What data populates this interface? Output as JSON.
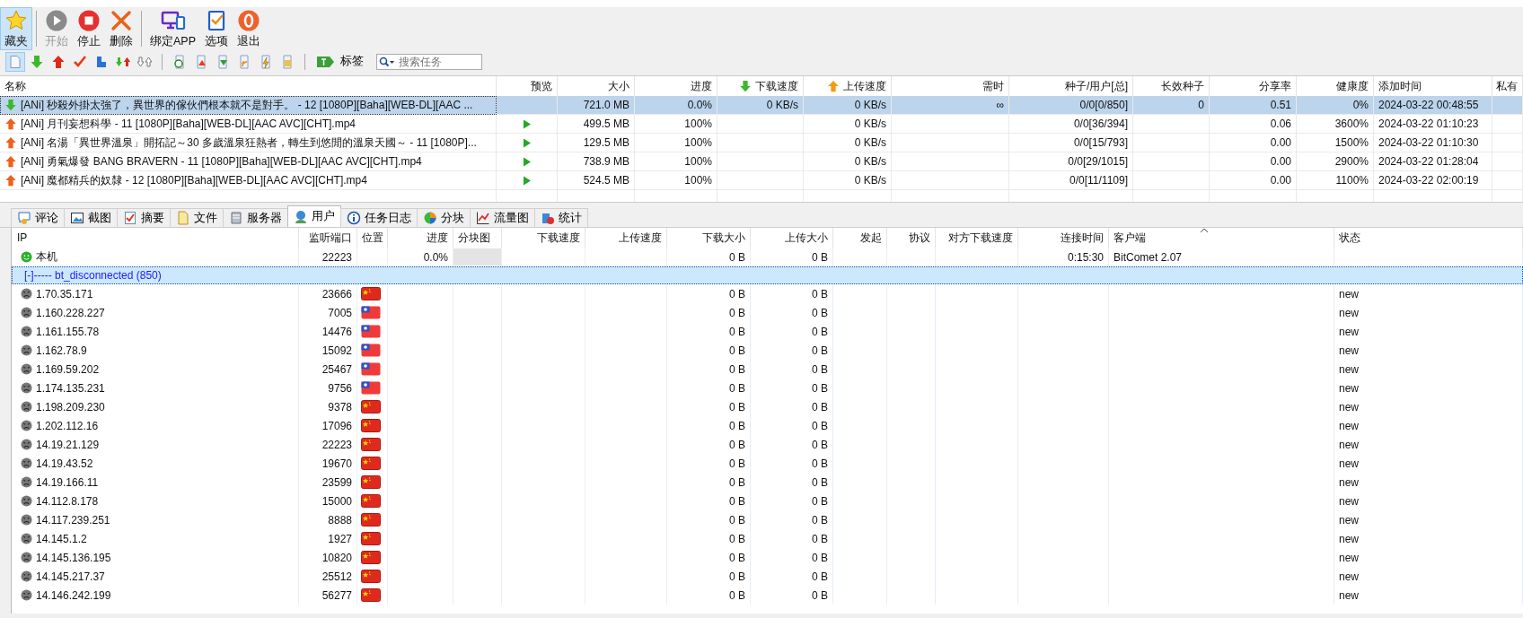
{
  "toolbar": {
    "buttons": [
      {
        "kind": "star",
        "label": "藏夹",
        "selected": true,
        "disabled": false
      },
      {
        "kind": "play",
        "label": "开始",
        "selected": false,
        "disabled": true
      },
      {
        "kind": "stop",
        "label": "停止",
        "selected": false,
        "disabled": false
      },
      {
        "kind": "delete",
        "label": "删除",
        "selected": false,
        "disabled": false
      },
      {
        "kind": "device",
        "label": "绑定APP",
        "selected": false,
        "disabled": false
      },
      {
        "kind": "options",
        "label": "选项",
        "selected": false,
        "disabled": false
      },
      {
        "kind": "exit",
        "label": "退出",
        "selected": false,
        "disabled": false
      }
    ]
  },
  "filter_bar": {
    "filters": [
      {
        "kind": "all",
        "selected": true
      },
      {
        "kind": "down",
        "selected": false
      },
      {
        "kind": "up",
        "selected": false
      },
      {
        "kind": "done",
        "selected": false
      },
      {
        "kind": "queue",
        "selected": false
      },
      {
        "kind": "updown",
        "selected": false
      },
      {
        "kind": "idle",
        "selected": false
      }
    ],
    "tools": [
      {
        "kind": "clock"
      },
      {
        "kind": "doc-up"
      },
      {
        "kind": "doc-down"
      },
      {
        "kind": "rss"
      },
      {
        "kind": "bolt"
      },
      {
        "kind": "folder"
      }
    ],
    "tag_button": "标签",
    "search": {
      "placeholder": "搜索任务"
    }
  },
  "tasks": {
    "columns": [
      "名称",
      "预览",
      "大小",
      "进度",
      "下载速度",
      "上传速度",
      "需时",
      "种子/用户[总]",
      "长效种子",
      "分享率",
      "健康度",
      "添加时间",
      "私有"
    ],
    "rows": [
      {
        "kind": "download",
        "selected": true,
        "preview": false,
        "name": "[ANi] 秒殺外掛太強了，異世界的傢伙們根本就不是對手。 - 12 [1080P][Baha][WEB-DL][AAC ...",
        "size": "721.0 MB",
        "progress": "0.0%",
        "download_speed": "0 KB/s",
        "upload_speed": "0 KB/s",
        "eta": "∞",
        "seeds_peers": "0/0[0/850]",
        "long_seeds": "0",
        "share_ratio": "0.51",
        "health": "0%",
        "added": "2024-03-22 00:48:55"
      },
      {
        "kind": "upload",
        "selected": false,
        "preview": true,
        "name": "[ANi] 月刊妄想科學 - 11 [1080P][Baha][WEB-DL][AAC AVC][CHT].mp4",
        "size": "499.5 MB",
        "progress": "100%",
        "upload_speed": "0 KB/s",
        "seeds_peers": "0/0[36/394]",
        "share_ratio": "0.06",
        "health": "3600%",
        "added": "2024-03-22 01:10:23"
      },
      {
        "kind": "upload",
        "selected": false,
        "preview": true,
        "name": "[ANi] 名湯「異世界溫泉」開拓記～30 多歲溫泉狂熱者，轉生到悠閒的溫泉天國～ - 11 [1080P]...",
        "size": "129.5 MB",
        "progress": "100%",
        "upload_speed": "0 KB/s",
        "seeds_peers": "0/0[15/793]",
        "share_ratio": "0.00",
        "health": "1500%",
        "added": "2024-03-22 01:10:30"
      },
      {
        "kind": "upload",
        "selected": false,
        "preview": true,
        "name": "[ANi] 勇氣爆發 BANG BRAVERN - 11 [1080P][Baha][WEB-DL][AAC AVC][CHT].mp4",
        "size": "738.9 MB",
        "progress": "100%",
        "upload_speed": "0 KB/s",
        "seeds_peers": "0/0[29/1015]",
        "share_ratio": "0.00",
        "health": "2900%",
        "added": "2024-03-22 01:28:04"
      },
      {
        "kind": "upload",
        "selected": false,
        "preview": true,
        "name": "[ANi] 魔都精兵的奴隸 - 12 [1080P][Baha][WEB-DL][AAC AVC][CHT].mp4",
        "size": "524.5 MB",
        "progress": "100%",
        "upload_speed": "0 KB/s",
        "seeds_peers": "0/0[11/1109]",
        "share_ratio": "0.00",
        "health": "1100%",
        "added": "2024-03-22 02:00:19"
      }
    ]
  },
  "tabs": [
    {
      "kind": "comment",
      "label": "评论",
      "selected": false
    },
    {
      "kind": "image",
      "label": "截图",
      "selected": false
    },
    {
      "kind": "check",
      "label": "摘要",
      "selected": false
    },
    {
      "kind": "file",
      "label": "文件",
      "selected": false
    },
    {
      "kind": "server",
      "label": "服务器",
      "selected": false
    },
    {
      "kind": "users",
      "label": "用户",
      "selected": true
    },
    {
      "kind": "info",
      "label": "任务日志",
      "selected": false
    },
    {
      "kind": "pie",
      "label": "分块",
      "selected": false
    },
    {
      "kind": "graph",
      "label": "流量图",
      "selected": false
    },
    {
      "kind": "stats",
      "label": "统计",
      "selected": false
    }
  ],
  "peers": {
    "columns": [
      "IP",
      "监听端口",
      "位置",
      "进度",
      "分块图",
      "下载速度",
      "上传速度",
      "下载大小",
      "上传大小",
      "发起",
      "协议",
      "对方下载速度",
      "连接时间",
      "客户端",
      "状态"
    ],
    "local": {
      "kind": "local",
      "ip": "本机",
      "port": "22223",
      "progress": "0.0%",
      "download_size": "0 B",
      "upload_size": "0 B",
      "connect_time": "0:15:30",
      "client": "BitComet 2.07"
    },
    "group": {
      "label": "[-]----- bt_disconnected (850)",
      "selected": true
    },
    "rows": [
      {
        "kind": "disconnected",
        "ip": "1.70.35.171",
        "port": "23666",
        "flag": {
          "kind": "cn"
        },
        "download_size": "0 B",
        "upload_size": "0 B",
        "status": "new"
      },
      {
        "kind": "disconnected",
        "ip": "1.160.228.227",
        "port": "7005",
        "flag": {
          "kind": "tw"
        },
        "download_size": "0 B",
        "upload_size": "0 B",
        "status": "new"
      },
      {
        "kind": "disconnected",
        "ip": "1.161.155.78",
        "port": "14476",
        "flag": {
          "kind": "tw"
        },
        "download_size": "0 B",
        "upload_size": "0 B",
        "status": "new"
      },
      {
        "kind": "disconnected",
        "ip": "1.162.78.9",
        "port": "15092",
        "flag": {
          "kind": "tw"
        },
        "download_size": "0 B",
        "upload_size": "0 B",
        "status": "new"
      },
      {
        "kind": "disconnected",
        "ip": "1.169.59.202",
        "port": "25467",
        "flag": {
          "kind": "tw"
        },
        "download_size": "0 B",
        "upload_size": "0 B",
        "status": "new"
      },
      {
        "kind": "disconnected",
        "ip": "1.174.135.231",
        "port": "9756",
        "flag": {
          "kind": "tw"
        },
        "download_size": "0 B",
        "upload_size": "0 B",
        "status": "new"
      },
      {
        "kind": "disconnected",
        "ip": "1.198.209.230",
        "port": "9378",
        "flag": {
          "kind": "cn"
        },
        "download_size": "0 B",
        "upload_size": "0 B",
        "status": "new"
      },
      {
        "kind": "disconnected",
        "ip": "1.202.112.16",
        "port": "17096",
        "flag": {
          "kind": "cn"
        },
        "download_size": "0 B",
        "upload_size": "0 B",
        "status": "new"
      },
      {
        "kind": "disconnected",
        "ip": "14.19.21.129",
        "port": "22223",
        "flag": {
          "kind": "cn"
        },
        "download_size": "0 B",
        "upload_size": "0 B",
        "status": "new"
      },
      {
        "kind": "disconnected",
        "ip": "14.19.43.52",
        "port": "19670",
        "flag": {
          "kind": "cn"
        },
        "download_size": "0 B",
        "upload_size": "0 B",
        "status": "new"
      },
      {
        "kind": "disconnected",
        "ip": "14.19.166.11",
        "port": "23599",
        "flag": {
          "kind": "cn"
        },
        "download_size": "0 B",
        "upload_size": "0 B",
        "status": "new"
      },
      {
        "kind": "disconnected",
        "ip": "14.112.8.178",
        "port": "15000",
        "flag": {
          "kind": "cn"
        },
        "download_size": "0 B",
        "upload_size": "0 B",
        "status": "new"
      },
      {
        "kind": "disconnected",
        "ip": "14.117.239.251",
        "port": "8888",
        "flag": {
          "kind": "cn"
        },
        "download_size": "0 B",
        "upload_size": "0 B",
        "status": "new"
      },
      {
        "kind": "disconnected",
        "ip": "14.145.1.2",
        "port": "1927",
        "flag": {
          "kind": "cn"
        },
        "download_size": "0 B",
        "upload_size": "0 B",
        "status": "new"
      },
      {
        "kind": "disconnected",
        "ip": "14.145.136.195",
        "port": "10820",
        "flag": {
          "kind": "cn"
        },
        "download_size": "0 B",
        "upload_size": "0 B",
        "status": "new"
      },
      {
        "kind": "disconnected",
        "ip": "14.145.217.37",
        "port": "25512",
        "flag": {
          "kind": "cn"
        },
        "download_size": "0 B",
        "upload_size": "0 B",
        "status": "new"
      },
      {
        "kind": "disconnected",
        "ip": "14.146.242.199",
        "port": "56277",
        "flag": {
          "kind": "cn"
        },
        "download_size": "0 B",
        "upload_size": "0 B",
        "status": "new"
      }
    ]
  }
}
